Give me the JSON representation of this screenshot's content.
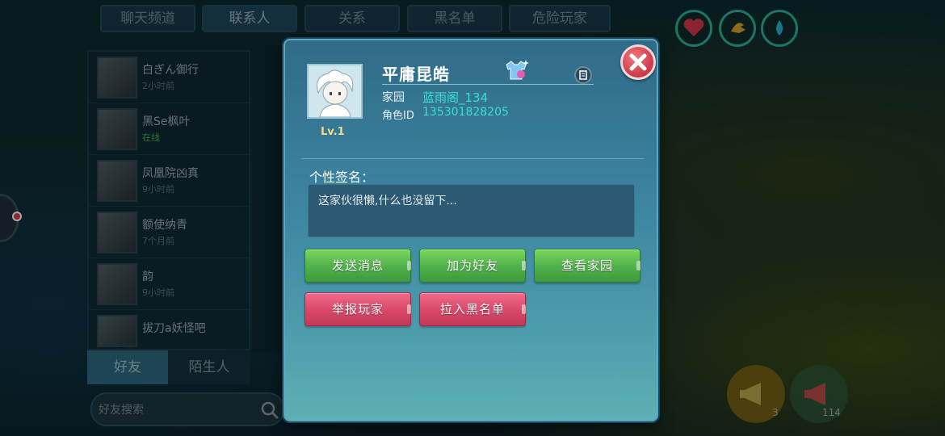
{
  "top_tabs": [
    {
      "label": "聊天频道"
    },
    {
      "label": "联系人",
      "active": true
    },
    {
      "label": "关系"
    },
    {
      "label": "黑名单"
    },
    {
      "label": "危险玩家"
    }
  ],
  "contacts": [
    {
      "name": "白ぎん御行",
      "status": "2小时前"
    },
    {
      "name": "黑Se枫叶",
      "status": "在线",
      "online": true
    },
    {
      "name": "凤凰院凶真",
      "status": "9小时前"
    },
    {
      "name": "额使纳青",
      "status": "7个月前"
    },
    {
      "name": "韵",
      "status": "9小时前"
    },
    {
      "name": "拔刀a妖怪吧",
      "status": ""
    }
  ],
  "bottom_tabs": {
    "friends": "好友",
    "strangers": "陌生人"
  },
  "search": {
    "placeholder": "好友搜索"
  },
  "round_buttons": {
    "horn_count": "3",
    "loud_count": "114"
  },
  "profile": {
    "player_name": "平庸昆皓",
    "level": "Lv.1",
    "home_label": "家园",
    "home_value": "蓝雨阁_134",
    "role_id_label": "角色ID",
    "role_id_value": "135301828205",
    "signature_title": "个性签名：",
    "signature_text": "这家伙很懒,什么也没留下..."
  },
  "actions": {
    "send_message": "发送消息",
    "add_friend": "加为好友",
    "view_home": "查看家园",
    "report_player": "举报玩家",
    "block": "拉入黑名单"
  },
  "colors": {
    "accent_cyan": "#37e0d6",
    "green_button": "#4fb04a",
    "red_button": "#d84867",
    "close_button": "#c9384a"
  }
}
